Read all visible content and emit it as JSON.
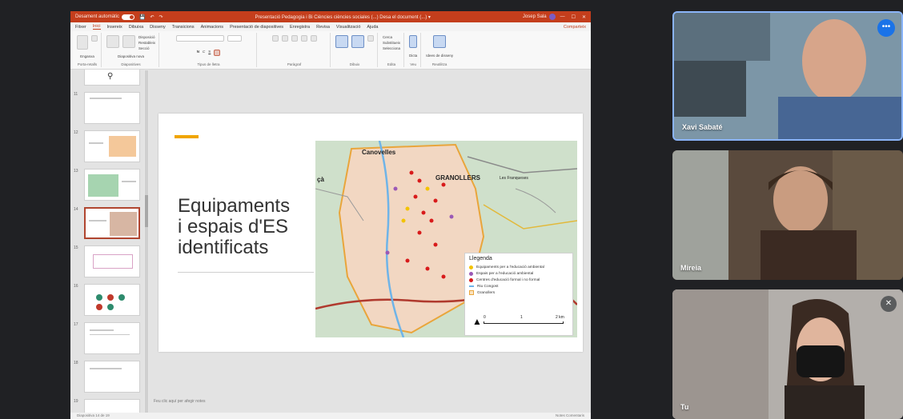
{
  "ppt": {
    "autosave": "Desament automàtic",
    "doc_title": "Presentació Pedagogia i Bi Ciències ciències sociales (...) Desa el document (...) ▾",
    "user": "Josep Sala",
    "menu": [
      "Fitxer",
      "Inici",
      "Insereix",
      "Dibuixa",
      "Disseny",
      "Transicions",
      "Animacions",
      "Presentació de diapositives",
      "Enregistra",
      "Revisa",
      "Visualització",
      "Ajuda"
    ],
    "share": "Comparteix",
    "ribbon_groups": [
      {
        "label": "Porta-retalls",
        "items": [
          "Enganxa"
        ]
      },
      {
        "label": "Diapositives",
        "items": [
          "Diapositiva nova",
          "Torna a fer servir diapositives",
          "Disposició",
          "Restableix",
          "Secció"
        ]
      },
      {
        "label": "Tipus de lletra",
        "items": [
          "N",
          "C",
          "S"
        ]
      },
      {
        "label": "Paràgraf",
        "items": []
      },
      {
        "label": "Dibuix",
        "items": [
          "Formes",
          "Organitza"
        ]
      },
      {
        "label": "Edita",
        "items": [
          "Cerca",
          "Substitueix",
          "Selecciona"
        ]
      },
      {
        "label": "Veu",
        "items": [
          "Dicta"
        ]
      },
      {
        "label": "Reutilitza",
        "items": [
          "Idees de disseny"
        ]
      }
    ],
    "thumb_numbers": [
      "11",
      "12",
      "13",
      "14",
      "15",
      "16",
      "17",
      "18",
      "19"
    ],
    "slide": {
      "title_line1": "Equipaments",
      "title_line2": "i espais d'ES",
      "title_line3": "identificats",
      "map": {
        "labels": {
          "canovelles": "Canovelles",
          "granollers": "GRANOLLERS",
          "ca": "çà",
          "other": "Les Franqueses"
        },
        "legend_title": "Llegenda",
        "legend_items": [
          {
            "label": "Equipaments per a l'educació ambiental",
            "color": "#f3c300",
            "kind": "dot"
          },
          {
            "label": "Espais per a l'educació ambiental",
            "color": "#9b59b6",
            "kind": "dot"
          },
          {
            "label": "Centres d'educació formal i no formal",
            "color": "#d81b1b",
            "kind": "dot"
          },
          {
            "label": "Riu Congost",
            "color": "#6fb4e8",
            "kind": "line"
          },
          {
            "label": "Granollers",
            "color": "#e9a53b",
            "kind": "box"
          }
        ],
        "scale_labels": [
          "0",
          "1",
          "2 km"
        ]
      }
    },
    "notes_placeholder": "Feu clic aquí per afegir notes",
    "status_left": "Diapositiva 14 de 19",
    "status_right": "Notes  Comentaris"
  },
  "participants": [
    {
      "name": "Xavi Sabaté",
      "active": true
    },
    {
      "name": "Mireia",
      "active": false
    },
    {
      "name": "Tu",
      "muted": true
    }
  ],
  "icons": {
    "more": "more-options-icon",
    "mic_off": "mic-off-icon"
  },
  "colors": {
    "ppt_accent": "#c43e1c",
    "meet_blue": "#1a73e8",
    "slide_accent": "#f0a500"
  }
}
